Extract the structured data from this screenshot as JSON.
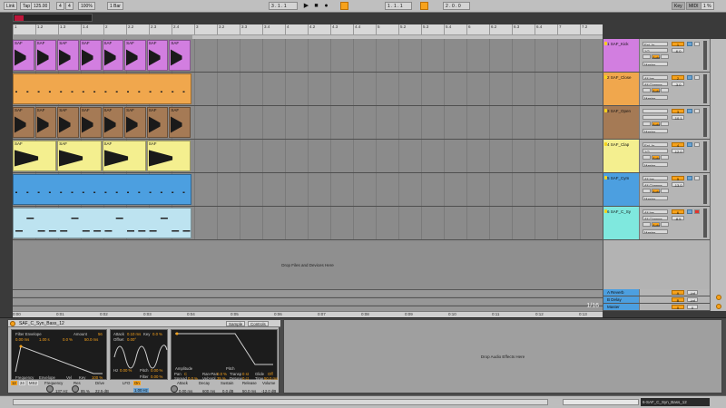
{
  "transport": {
    "link": "Link",
    "tap": "Tap",
    "tempo": "125.00",
    "sig_num": "4",
    "sig_den": "4",
    "zoom": "100%",
    "quantize": "1 Bar",
    "position": "3 . 1 . 1",
    "loop_start": "1 . 1 . 1",
    "loop_length": "2 . 0 . 0",
    "key": "Key",
    "midi": "MIDI",
    "cpu": "1 %",
    "play_icon": "play-icon",
    "stop_icon": "stop-icon",
    "record_icon": "record-icon"
  },
  "ruler_ticks": [
    "1",
    "1.2",
    "1.3",
    "1.4",
    "2",
    "2.2",
    "2.3",
    "2.4",
    "3",
    "3.2",
    "3.3",
    "3.4",
    "4",
    "4.2",
    "4.3",
    "4.4",
    "5",
    "5.2",
    "5.3",
    "5.4",
    "6",
    "6.2",
    "6.3",
    "6.4",
    "7",
    "7.2"
  ],
  "time_ticks": [
    "0:00",
    "0:01",
    "0:02",
    "0:03",
    "0:04",
    "0:05",
    "0:06",
    "0:07",
    "0:08",
    "0:09",
    "0:10",
    "0:11",
    "0:12",
    "0:13"
  ],
  "clip_label": "SAF",
  "tracks": [
    {
      "name": "1 SAF_Kick",
      "color": "#d27ee0",
      "clip_color": "#d27ee0",
      "input": "Ext. In",
      "channel": "1/2",
      "number": "1",
      "volume": "-6.0",
      "monitor": "Auto"
    },
    {
      "name": "2 SAF_Close",
      "color": "#f0a74d",
      "clip_color": "#f0a74d",
      "input": "All Ins",
      "channel": "All Channe",
      "number": "2",
      "volume": "-3.0",
      "monitor": "Auto"
    },
    {
      "name": "3 SAF_Open",
      "color": "#a57a55",
      "clip_color": "#a57a55",
      "input": "",
      "channel": "",
      "number": "3",
      "volume": "-10.1",
      "monitor": "Auto"
    },
    {
      "name": "4 SAF_Clap",
      "color": "#f4ef8f",
      "clip_color": "#f4ef8f",
      "input": "Ext. In",
      "channel": "1/2",
      "number": "4",
      "volume": "-12.0",
      "monitor": "Auto"
    },
    {
      "name": "5 SAF_Cym",
      "color": "#4c9fe0",
      "clip_color": "#4c9fe0",
      "input": "All Ins",
      "channel": "All Channe",
      "number": "5",
      "volume": "-13.0",
      "monitor": "Auto"
    },
    {
      "name": "6 SAF_C_Sy",
      "color": "#7fe8de",
      "clip_color": "#bde3f0",
      "input": "All Ins",
      "channel": "All Channe",
      "number": "6",
      "volume": "-8.5",
      "monitor": "Auto"
    }
  ],
  "output": "Master",
  "drop_files_text": "Drop Files and Devices Here",
  "returns": [
    {
      "name": "A Reverb",
      "color": "#4c9fe0",
      "number": "A",
      "volume": "-inf"
    },
    {
      "name": "B Delay",
      "color": "#4c9fe0",
      "number": "B",
      "volume": "-inf"
    }
  ],
  "master": {
    "name": "Master",
    "output": "1/2",
    "number": "0",
    "volume": "0"
  },
  "zoom_indicator": "1/16",
  "device": {
    "title": "SAF_C_Syn_Bass_12",
    "tab_sample": "Sample",
    "tab_controls": "Controls",
    "filter_env_label": "Filter Envelope",
    "amount_label": "Amount",
    "amount_value": "56",
    "env_values": [
      "0.00 ms",
      "1.00 s",
      "0.0 %",
      "50.0 ms"
    ],
    "frequency_label": "Frequency",
    "envelope_label": "Envelope",
    "vel_label": "Vel",
    "key_label": "Key",
    "key_value": "100 %",
    "attack_label": "Attack",
    "attack_value": "0.10 ms",
    "key2_label": "Key",
    "key2_value": "0.0 %",
    "offset_label": "Offset",
    "offset_value": "0.00°",
    "amplitude_label": "Amplitude",
    "pitch_label": "Pitch",
    "pan_label": "Pan",
    "pan_value": "C",
    "ran_pan_label": "Ran-Pan",
    "ran_pan_value": "0.0 %",
    "transp_label": "Transp",
    "transp_value": "0 st",
    "glide_label": "Glide",
    "glide_value": "Off",
    "spread_label": "Spread",
    "spread_value": "0.0 %",
    "vel_vol_label": "Vel>Vol",
    "vel_vol_value": "35 %",
    "detune_label": "Detune",
    "detune_value": "0 ct",
    "time_label": "Time",
    "time_value": "50.0 ms",
    "hz_label": "Hz",
    "hz_value": "0.00 %",
    "pitch2_label": "Pitch",
    "pitch2_value": "0.00 %",
    "filter2_label": "Filter",
    "filter2_value": "0.00 %",
    "filter_type": "12",
    "filter_type2": "24",
    "filter_mode": "MS2",
    "freq_label": "Frequency",
    "freq_value": "137 Hz",
    "res_label": "Res",
    "res_value": "85 %",
    "drive_label": "Drive",
    "drive_value": "22.5 dB",
    "lfo_label": "LFO",
    "lfo_on": "On",
    "lfo_rate": "1.00 Hz",
    "attack2_label": "Attack",
    "attack2_value": "0.00 ms",
    "decay_label": "Decay",
    "decay_value": "600 ms",
    "sustain_label": "Sustain",
    "sustain_value": "0.0 dB",
    "release_label": "Release",
    "release_value": "50.0 ms",
    "volume_label": "Volume",
    "volume_value": "-12.0 dB"
  },
  "fx_drop_text": "Drop Audio Effects Here",
  "status_track": "6-SAF_C_Syn_Bass_12"
}
